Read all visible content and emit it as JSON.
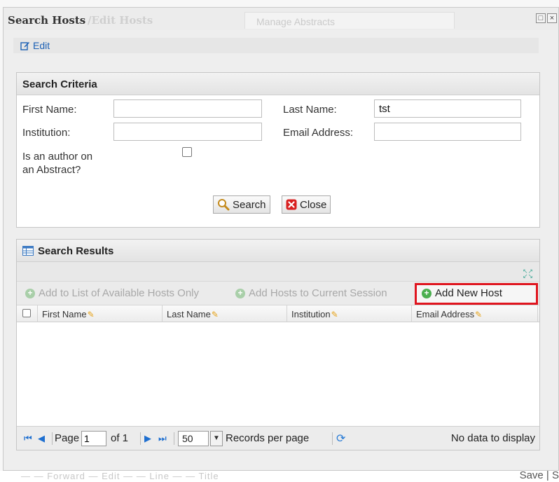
{
  "dialog": {
    "tabs": [
      "Search Hosts",
      "/Edit Hosts",
      "Manage Abstracts"
    ],
    "window_buttons": [
      "□",
      "×"
    ]
  },
  "edit_bar": {
    "edit_label": "Edit"
  },
  "criteria": {
    "heading": "Search Criteria",
    "first_name_label": "First Name:",
    "first_name_value": "",
    "last_name_label": "Last Name:",
    "last_name_value": "tst",
    "institution_label": "Institution:",
    "institution_value": "",
    "email_label": "Email Address:",
    "email_value": "",
    "author_label_line1": "Is an author on",
    "author_label_line2": "an Abstract?",
    "author_checked": false,
    "search_button": "Search",
    "close_button": "Close"
  },
  "results": {
    "heading": "Search Results",
    "actions": {
      "add_available": "Add to List of Available Hosts Only",
      "add_session": "Add Hosts to Current Session",
      "add_new_host": "Add New Host"
    },
    "columns": [
      "First Name",
      "Last Name",
      "Institution",
      "Email Address"
    ],
    "rows": [],
    "pager": {
      "page_label": "Page",
      "page_value": "1",
      "of_label": "of 1",
      "page_size": "50",
      "records_label": "Records per page",
      "status": "No data to display"
    }
  },
  "background": {
    "footer_left": "— — Forward — Edit — — Line — — Title",
    "footer_right": "Save | S"
  },
  "colors": {
    "link_blue": "#1a5fb4",
    "highlight_red": "#e0151f",
    "add_green": "#4caf50"
  }
}
